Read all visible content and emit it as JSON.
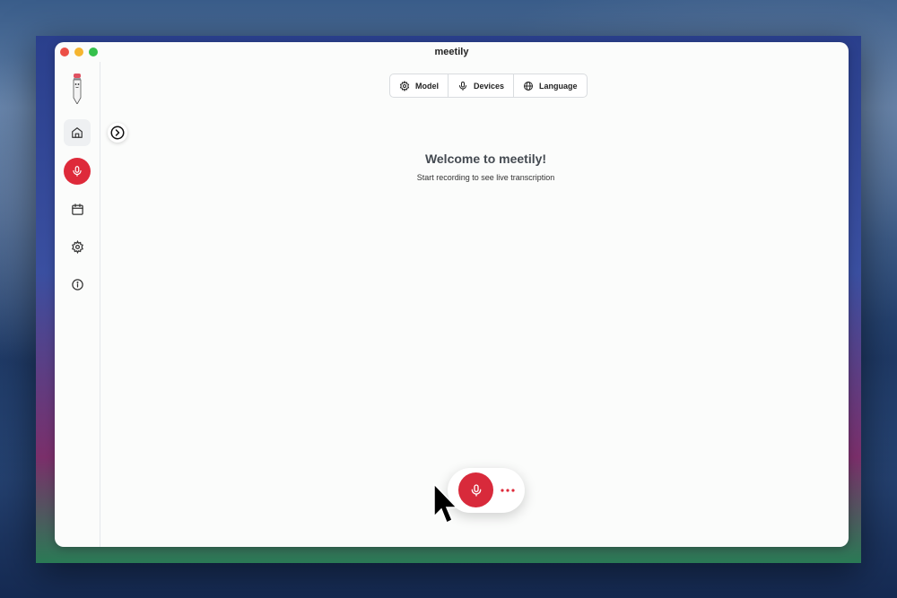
{
  "window": {
    "title": "meetily"
  },
  "toolbar": {
    "model_label": "Model",
    "devices_label": "Devices",
    "language_label": "Language"
  },
  "welcome": {
    "title": "Welcome to meetily!",
    "subtitle": "Start recording to see live transcription"
  },
  "sidebar": {
    "items": [
      {
        "name": "home",
        "icon": "home-icon",
        "active": true
      },
      {
        "name": "record",
        "icon": "microphone-icon",
        "accent": "#de2a3a"
      },
      {
        "name": "calendar",
        "icon": "calendar-icon"
      },
      {
        "name": "settings",
        "icon": "gear-icon"
      },
      {
        "name": "info",
        "icon": "info-icon"
      }
    ]
  },
  "colors": {
    "accent": "#de2a3a",
    "window_bg": "#fbfcfb",
    "border": "#d9dcdf"
  }
}
